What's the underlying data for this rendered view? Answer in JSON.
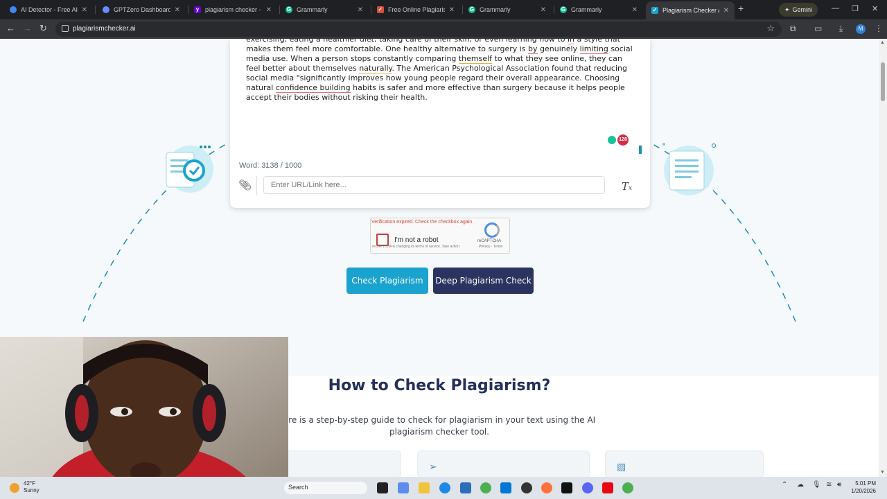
{
  "browser": {
    "tabs": [
      {
        "label": "AI Detector - Free AI Ch",
        "favicon_color": "#4285f4",
        "active": false
      },
      {
        "label": "GPTZero Dashboard",
        "favicon_color": "#6b8cff",
        "active": false
      },
      {
        "label": "plagiarism checker - Yal",
        "favicon_color": "#6001d2",
        "active": false
      },
      {
        "label": "Grammarly",
        "favicon_color": "#15c39a",
        "active": false
      },
      {
        "label": "Free Online Plagiarism C",
        "favicon_color": "#d94f3d",
        "active": false
      },
      {
        "label": "Grammarly",
        "favicon_color": "#15c39a",
        "active": false
      },
      {
        "label": "Grammarly",
        "favicon_color": "#15c39a",
        "active": false
      },
      {
        "label": "Plagiarism Checker AI",
        "favicon_color": "#1ba3cf",
        "active": true
      }
    ],
    "new_tab": "+",
    "gemini_label": "Gemini",
    "url": "plagiarismchecker.ai",
    "profile_initial": "M"
  },
  "editor": {
    "text_segments": [
      {
        "t": "exercising, eating a healthier diet, taking care of their skin, or even learning how to ",
        "u": ""
      },
      {
        "t": "in",
        "u": "red"
      },
      {
        "t": " a style that makes them feel more comfortable. One healthy alternative to surgery is ",
        "u": ""
      },
      {
        "t": "by",
        "u": "red"
      },
      {
        "t": " genuinely ",
        "u": ""
      },
      {
        "t": "limiting",
        "u": "red"
      },
      {
        "t": " social media use. When a person stops constantly comparing ",
        "u": ""
      },
      {
        "t": "themself",
        "u": "yel"
      },
      {
        "t": " to what they see online, they can feel better about themselves ",
        "u": ""
      },
      {
        "t": "naturally",
        "u": "yel"
      },
      {
        "t": ". The American Psychological Association found that reducing social media \"significantly improves how young people regard their overall appearance. Choosing natural ",
        "u": ""
      },
      {
        "t": "confidence building",
        "u": "red"
      },
      {
        "t": " habits is safer and more effective than surgery because it helps people accept their bodies without risking their health.",
        "u": ""
      }
    ],
    "grammarly_count": "128",
    "word_count": "Word: 3138 / 1000",
    "url_placeholder": "Enter URL/Link here..."
  },
  "captcha": {
    "error": "Verification expired. Check the checkbox again.",
    "label": "I'm not a robot",
    "brand": "reCAPTCHA",
    "links": "Privacy - Terms",
    "note": "reCAPTCHA is changing its terms of service. Take action."
  },
  "actions": {
    "check_label": "Check Plagiarism",
    "deep_label": "Deep Plagiarism Check"
  },
  "howto": {
    "title": "How to Check Plagiarism?",
    "subtitle": "ere is a step-by-step guide to check for plagiarism in your text using the AI plagiarism checker tool."
  },
  "taskbar": {
    "weather_temp": "42°F",
    "weather_desc": "Sunny",
    "search_label": "Search",
    "time": "5:01 PM",
    "date": "1/20/2026"
  }
}
